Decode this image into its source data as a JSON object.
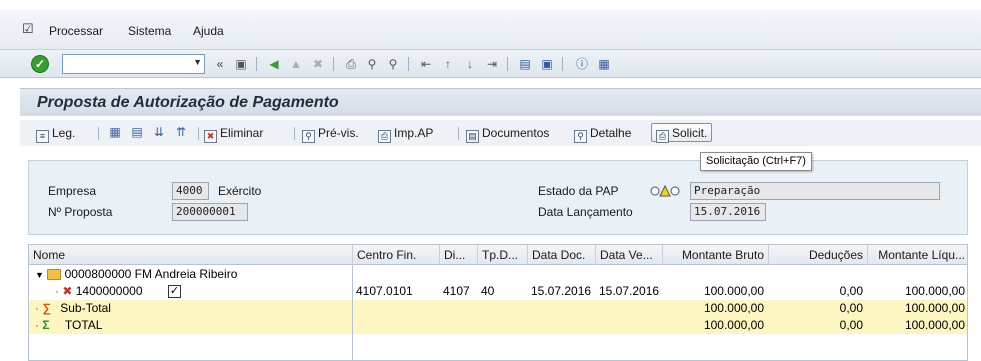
{
  "menubar": {
    "items": [
      {
        "label": "Processar"
      },
      {
        "label": "Sistema"
      },
      {
        "label": "Ajuda"
      }
    ]
  },
  "toolbar": {
    "command_value": "",
    "icons": [
      "ok-icon",
      "back-icon",
      "save-icon",
      "nav-back-icon",
      "nav-exit-icon",
      "nav-cancel-icon",
      "print-icon",
      "find-icon",
      "find-next-icon",
      "first-page-icon",
      "prev-page-icon",
      "next-page-icon",
      "last-page-icon",
      "new-session-icon",
      "shortcut-icon",
      "help-icon",
      "layout-icon"
    ]
  },
  "title": "Proposta de Autorização de Pagamento",
  "app_toolbar": {
    "leg": "Leg.",
    "eliminar": "Eliminar",
    "previs": "Pré-vis.",
    "impap": "Imp.AP",
    "documentos": "Documentos",
    "detalhe": "Detalhe",
    "solicit": "Solicit."
  },
  "tooltip": "Solicitação  (Ctrl+F7)",
  "form": {
    "empresa_label": "Empresa",
    "empresa_value": "4000",
    "exercicio_label": "Exército",
    "proposta_label": "Nº Proposta",
    "proposta_value": "200000001",
    "estado_label": "Estado da PAP",
    "estado_value": "Preparação",
    "data_label": "Data Lançamento",
    "data_value": "15.07.2016"
  },
  "grid": {
    "columns": [
      "Nome",
      "Centro Fin.",
      "Di...",
      "Tp.D...",
      "Data Doc.",
      "Data Ve...",
      "Montante Bruto",
      "Deduções",
      "Montante Líqu..."
    ],
    "folder_row": "0000800000 FM Andreia Ribeiro",
    "doc_row": {
      "nome": "1400000000",
      "centro": "4107.0101",
      "di": "4107",
      "tp": "40",
      "data_doc": "15.07.2016",
      "data_ve": "15.07.2016",
      "bruto": "100.000,00",
      "deducoes": "0,00",
      "liquido": "100.000,00"
    },
    "subtotal_row": {
      "nome": "Sub-Total",
      "bruto": "100.000,00",
      "deducoes": "0,00",
      "liquido": "100.000,00"
    },
    "total_row": {
      "nome": "TOTAL",
      "bruto": "100.000,00",
      "deducoes": "0,00",
      "liquido": "100.000,00"
    }
  },
  "colors": {
    "title_bar": "#d3dce7",
    "total_row": "#fdf5c2",
    "ok_green": "#3c9b33"
  }
}
